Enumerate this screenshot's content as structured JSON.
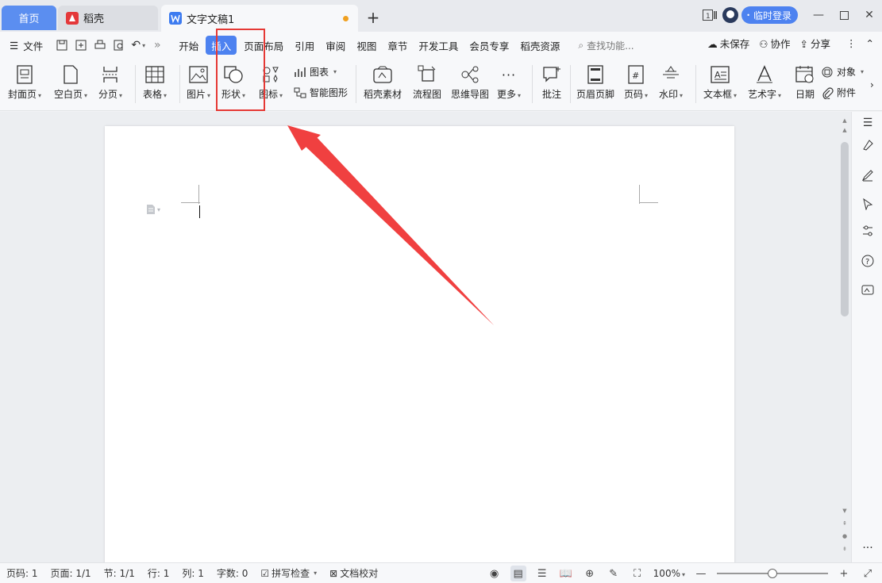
{
  "titlebar": {
    "home_tab": "首页",
    "daoke_tab": "稻壳",
    "doc_tab": "文字文稿1",
    "add_tab": "+",
    "login": "临时登录",
    "page_indicator": "1"
  },
  "menubar": {
    "file": "文件",
    "items": [
      "开始",
      "插入",
      "页面布局",
      "引用",
      "审阅",
      "视图",
      "章节",
      "开发工具",
      "会员专享",
      "稻壳资源"
    ],
    "active": "插入",
    "search": "查找功能...",
    "unsaved": "未保存",
    "collab": "协作",
    "share": "分享"
  },
  "ribbon": {
    "cover": "封面页",
    "blank": "空白页",
    "pagebreak": "分页",
    "table": "表格",
    "picture": "图片",
    "shape": "形状",
    "icon": "图标",
    "chart": "图表",
    "smartart": "智能图形",
    "daoke_assets": "稻壳素材",
    "flowchart": "流程图",
    "mindmap": "思维导图",
    "more": "更多",
    "comment": "批注",
    "headerfooter": "页眉页脚",
    "pagenum": "页码",
    "watermark": "水印",
    "textbox": "文本框",
    "wordart": "艺术字",
    "date": "日期",
    "object": "对象",
    "attachment": "附件"
  },
  "statusbar": {
    "page_num": "页码: 1",
    "pages": "页面: 1/1",
    "section": "节: 1/1",
    "row": "行: 1",
    "col": "列: 1",
    "wordcount": "字数: 0",
    "spellcheck": "拼写检查",
    "proofread": "文档校对",
    "zoom": "100%"
  },
  "colors": {
    "accent": "#4d82f0",
    "highlight": "#e53935",
    "arrow": "#f04040"
  }
}
